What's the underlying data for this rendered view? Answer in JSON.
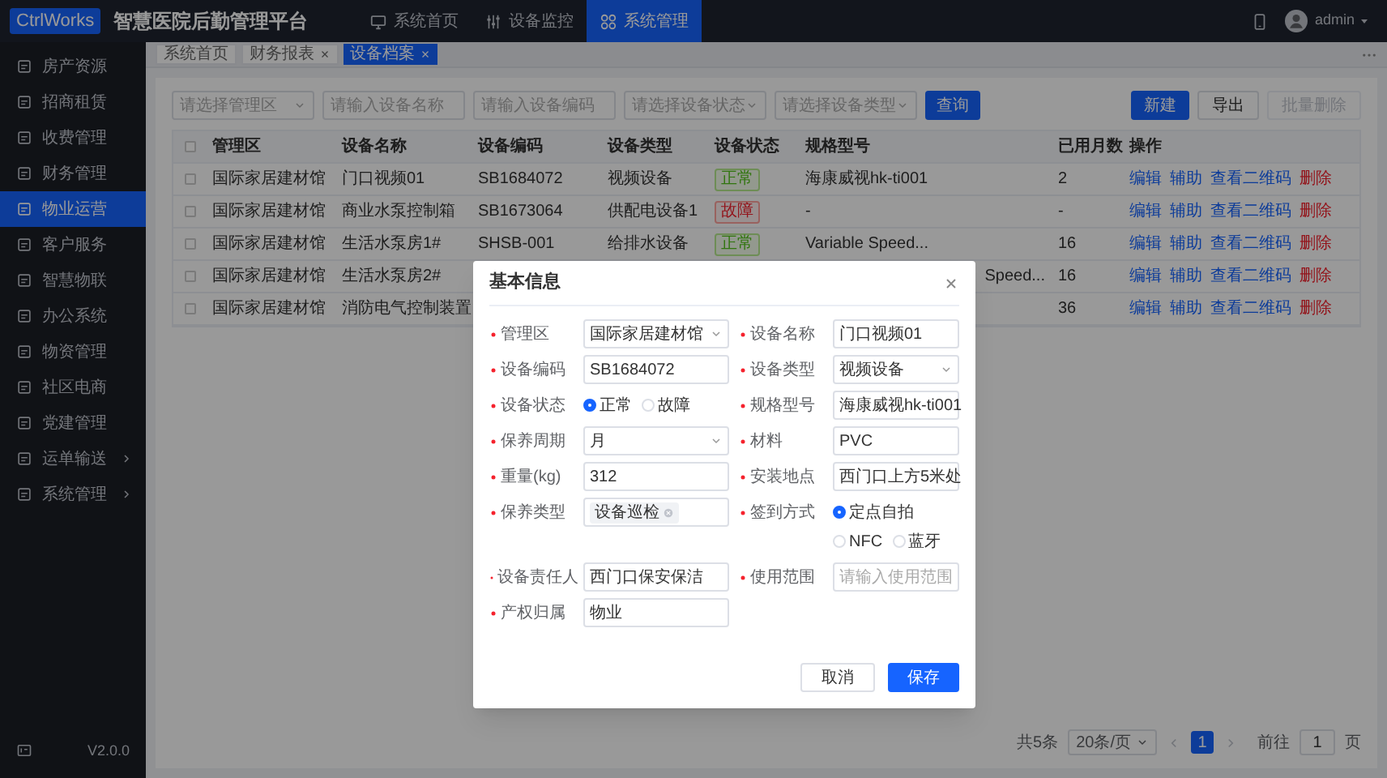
{
  "topbar": {
    "logo": "CtrlWorks",
    "title": "智慧医院后勤管理平台",
    "user": "admin",
    "nav": [
      {
        "label": "系统首页",
        "selected": false
      },
      {
        "label": "设备监控",
        "selected": false
      },
      {
        "label": "系统管理",
        "selected": true
      }
    ]
  },
  "sidebar": {
    "version": "V2.0.0",
    "items": [
      {
        "label": "房产资源",
        "selected": false,
        "expandable": false
      },
      {
        "label": "招商租赁",
        "selected": false,
        "expandable": false
      },
      {
        "label": "收费管理",
        "selected": false,
        "expandable": false
      },
      {
        "label": "财务管理",
        "selected": false,
        "expandable": false
      },
      {
        "label": "物业运营",
        "selected": true,
        "expandable": false
      },
      {
        "label": "客户服务",
        "selected": false,
        "expandable": false
      },
      {
        "label": "智慧物联",
        "selected": false,
        "expandable": false
      },
      {
        "label": "办公系统",
        "selected": false,
        "expandable": false
      },
      {
        "label": "物资管理",
        "selected": false,
        "expandable": false
      },
      {
        "label": "社区电商",
        "selected": false,
        "expandable": false
      },
      {
        "label": "党建管理",
        "selected": false,
        "expandable": false
      },
      {
        "label": "运单输送",
        "selected": false,
        "expandable": true
      },
      {
        "label": "系统管理",
        "selected": false,
        "expandable": true
      }
    ]
  },
  "tabs": [
    {
      "label": "系统首页",
      "closable": false,
      "selected": false
    },
    {
      "label": "财务报表",
      "closable": true,
      "selected": false
    },
    {
      "label": "设备档案",
      "closable": true,
      "selected": true
    }
  ],
  "filters": [
    {
      "kind": "select",
      "placeholder": "请选择管理区"
    },
    {
      "kind": "input",
      "placeholder": "请输入设备名称"
    },
    {
      "kind": "input",
      "placeholder": "请输入设备编码"
    },
    {
      "kind": "select",
      "placeholder": "请选择设备状态"
    },
    {
      "kind": "select",
      "placeholder": "请选择设备类型"
    }
  ],
  "search_button": "查询",
  "toolbar": [
    {
      "label": "新建",
      "kind": "primary",
      "disabled": false
    },
    {
      "label": "导出",
      "kind": "default",
      "disabled": false
    },
    {
      "label": "批量删除",
      "kind": "default",
      "disabled": true
    }
  ],
  "table": {
    "select_all_checked": false,
    "columns": [
      "管理区",
      "设备名称",
      "设备编码",
      "设备类型",
      "设备状态",
      "规格型号",
      "已用月数",
      "操作"
    ],
    "rows": [
      {
        "checked": false,
        "area": "国际家居建材馆",
        "name": "门口视频01",
        "code": "SB1684072",
        "type": "视频设备",
        "status": {
          "label": "正常",
          "kind": "ok"
        },
        "model": "海康威视hk-ti001",
        "months": "2",
        "actions": [
          {
            "label": "编辑",
            "kind": "link"
          },
          {
            "label": "辅助",
            "kind": "link"
          },
          {
            "label": "查看二维码",
            "kind": "link"
          },
          {
            "label": "删除",
            "kind": "danger"
          }
        ]
      },
      {
        "checked": false,
        "area": "国际家居建材馆",
        "name": "商业水泵控制箱",
        "code": "SB1673064",
        "type": "供配电设备1",
        "status": {
          "label": "故障",
          "kind": "fault"
        },
        "model": "-",
        "months": "-",
        "actions": [
          {
            "label": "编辑",
            "kind": "link"
          },
          {
            "label": "辅助",
            "kind": "link"
          },
          {
            "label": "查看二维码",
            "kind": "link"
          },
          {
            "label": "删除",
            "kind": "danger"
          }
        ]
      },
      {
        "checked": false,
        "area": "国际家居建材馆",
        "name": "生活水泵房1#",
        "code": "SHSB-001",
        "type": "给排水设备",
        "status": {
          "label": "正常",
          "kind": "ok"
        },
        "model": "Variable Speed...",
        "months": "16",
        "actions": [
          {
            "label": "编辑",
            "kind": "link"
          },
          {
            "label": "辅助",
            "kind": "link"
          },
          {
            "label": "查看二维码",
            "kind": "link"
          },
          {
            "label": "删除",
            "kind": "danger"
          }
        ]
      },
      {
        "checked": false,
        "area": "国际家居建材馆",
        "name": "生活水泵房2#",
        "model": "Speed...",
        "model_cut": true,
        "months": "16",
        "actions": [
          {
            "label": "编辑",
            "kind": "link"
          },
          {
            "label": "辅助",
            "kind": "link"
          },
          {
            "label": "查看二维码",
            "kind": "link"
          },
          {
            "label": "删除",
            "kind": "danger"
          }
        ]
      },
      {
        "checked": false,
        "area": "国际家居建材馆",
        "name": "消防电气控制装置",
        "months": "36",
        "actions": [
          {
            "label": "编辑",
            "kind": "link"
          },
          {
            "label": "辅助",
            "kind": "link"
          },
          {
            "label": "查看二维码",
            "kind": "link"
          },
          {
            "label": "删除",
            "kind": "danger"
          }
        ]
      }
    ]
  },
  "pagination": {
    "total": "共5条",
    "page_size": "20条/页",
    "pages": [
      {
        "label": "1",
        "selected": true
      }
    ],
    "goto_label": "前往",
    "goto_value": "1",
    "goto_suffix": "页"
  },
  "dialog": {
    "title": "基本信息",
    "cancel": "取消",
    "save": "保存",
    "fields": [
      {
        "label": "管理区",
        "required": true,
        "kind": "select",
        "value": "国际家居建材馆"
      },
      {
        "label": "设备名称",
        "required": true,
        "kind": "input",
        "value": "门口视频01"
      },
      {
        "label": "设备编码",
        "required": true,
        "kind": "input",
        "value": "SB1684072"
      },
      {
        "label": "设备类型",
        "required": true,
        "kind": "select",
        "value": "视频设备"
      },
      {
        "label": "设备状态",
        "required": true,
        "kind": "radio",
        "options": [
          {
            "label": "正常",
            "selected": true
          },
          {
            "label": "故障",
            "selected": false
          }
        ]
      },
      {
        "label": "规格型号",
        "required": true,
        "kind": "input",
        "value": "海康威视hk-ti001"
      },
      {
        "label": "保养周期",
        "required": true,
        "kind": "select",
        "value": "月"
      },
      {
        "label": "材料",
        "required": true,
        "kind": "input",
        "value": "PVC"
      },
      {
        "label": "重量(kg)",
        "required": true,
        "kind": "input",
        "value": "312"
      },
      {
        "label": "安装地点",
        "required": true,
        "kind": "input",
        "value": "西门口上方5米处"
      },
      {
        "label": "保养类型",
        "required": true,
        "kind": "tags",
        "tags": [
          "设备巡检"
        ]
      },
      {
        "label": "签到方式",
        "required": true,
        "kind": "radio",
        "options": [
          {
            "label": "定点自拍",
            "selected": true
          },
          {
            "label": "NFC",
            "selected": false
          },
          {
            "label": "蓝牙",
            "selected": false
          }
        ]
      },
      {
        "label": "设备责任人",
        "required": true,
        "kind": "input",
        "value": "西门口保安保洁"
      },
      {
        "label": "使用范围",
        "required": true,
        "kind": "input",
        "placeholder": "请输入使用范围"
      },
      {
        "label": "产权归属",
        "required": true,
        "kind": "input",
        "value": "物业"
      }
    ]
  }
}
